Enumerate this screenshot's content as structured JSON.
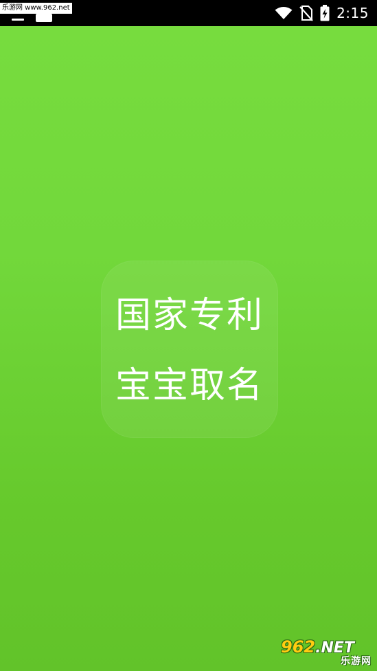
{
  "status_bar": {
    "watermark_text": "乐游网 www.962.net",
    "time": "2:15",
    "icons": [
      "wifi-icon",
      "no-sim-icon",
      "battery-charging-icon"
    ],
    "background": "#000000",
    "foreground": "#ffffff"
  },
  "splash": {
    "logo_line_1": "国家专利",
    "logo_line_2": "宝宝取名",
    "background_top": "#77dc3e",
    "background_bottom": "#62c32a",
    "text_color": "#ffffff"
  },
  "brand_badge": {
    "top_text": "962",
    "top_suffix": ".NET",
    "bottom_text": "乐游网",
    "accent": "#ffcc11"
  }
}
